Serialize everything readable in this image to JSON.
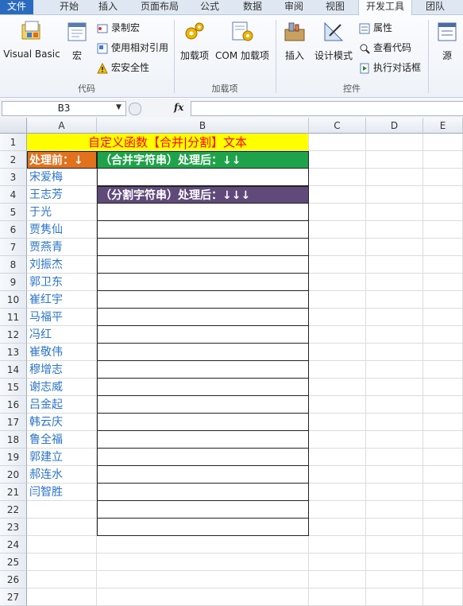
{
  "tabs": [
    "文件",
    "开始",
    "插入",
    "页面布局",
    "公式",
    "数据",
    "审阅",
    "视图",
    "开发工具",
    "团队"
  ],
  "ribbon": {
    "code_group": {
      "label": "代码",
      "visual_basic": "Visual Basic",
      "macro": "宏",
      "record_macro": "录制宏",
      "relative_ref": "使用相对引用",
      "macro_security": "宏安全性"
    },
    "addins_group": {
      "label": "加载项",
      "addins": "加载项",
      "com_addins": "COM 加载项"
    },
    "controls_group": {
      "label": "控件",
      "insert": "插入",
      "design_mode": "设计模式",
      "properties": "属性",
      "view_code": "查看代码",
      "run_dialog": "执行对话框"
    },
    "source": "源"
  },
  "formula_bar": {
    "namebox": "B3",
    "fx": "fx",
    "value": ""
  },
  "sheet": {
    "columns": [
      "A",
      "B",
      "C",
      "D",
      "E"
    ],
    "rows": [
      "1",
      "2",
      "3",
      "4",
      "5",
      "6",
      "7",
      "8",
      "9",
      "10",
      "11",
      "12",
      "13",
      "14",
      "15",
      "16",
      "17",
      "18",
      "19",
      "20",
      "21",
      "22",
      "23",
      "24",
      "25",
      "26",
      "27"
    ],
    "title": "自定义函数【合并|分割】文本",
    "a2": "处理前：↓",
    "b2": "（合并字符串）处理后：↓↓",
    "b4": "（分割字符串）处理后：↓↓↓",
    "names": [
      "宋爱梅",
      "王志芳",
      "于光",
      "贾隽仙",
      "贾燕青",
      "刘振杰",
      "郭卫东",
      "崔红宇",
      "马福平",
      "冯红",
      "崔敬伟",
      "穆增志",
      "谢志威",
      "吕金起",
      "韩云庆",
      "鲁全福",
      "郭建立",
      "郝连水",
      "闫智胜"
    ]
  },
  "colors": {
    "title_bg": "#ffff00",
    "title_text": "#ff0000",
    "a2_bg": "#e2711d",
    "b2_bg": "#1fa34a",
    "b4_bg": "#5f4a7a",
    "name_text": "#2a74c9"
  }
}
